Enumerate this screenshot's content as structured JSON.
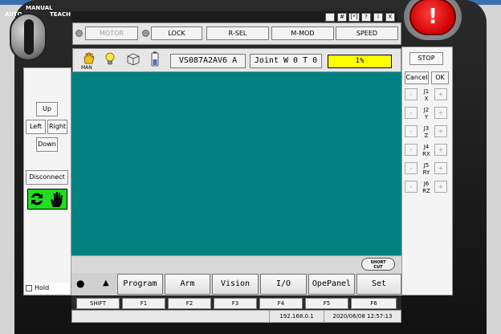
{
  "mode": {
    "auto": "AUTO",
    "manual": "MANUAL",
    "teach": "TEACH"
  },
  "window_buttons": [
    "#",
    "[*]",
    "?",
    "i",
    "X"
  ],
  "top_buttons": {
    "motor": "MOTOR",
    "lock": "LOCK",
    "rsel": "R-SEL",
    "mmod": "M-MOD",
    "speed": "SPEED"
  },
  "status": {
    "man_label": "MAN",
    "robot_name": "VS087A2AV6 A",
    "coord": "Joint  W 0 T 0",
    "speed_value": "1%"
  },
  "left_panel": {
    "up": "Up",
    "left": "Left",
    "right": "Right",
    "down": "Down",
    "disconnect": "Disconnect",
    "hold": "Hold"
  },
  "right_panel": {
    "stop": "STOP",
    "cancel": "Cancel",
    "ok": "OK",
    "minus": "-",
    "plus": "+",
    "joints": [
      {
        "j": "J1",
        "axis": "X"
      },
      {
        "j": "J2",
        "axis": "Y"
      },
      {
        "j": "J3",
        "axis": "Z"
      },
      {
        "j": "J4",
        "axis": "RX"
      },
      {
        "j": "J5",
        "axis": "RY"
      },
      {
        "j": "J6",
        "axis": "RZ"
      }
    ]
  },
  "shortcut": {
    "line1": "SHORT",
    "line2": "CUT"
  },
  "menu": {
    "circle": "●",
    "triangle": "▲",
    "items": [
      "Program",
      "Arm",
      "Vision",
      "I/O",
      "OpePanel",
      "Set"
    ]
  },
  "fkeys": [
    "SHIFT",
    "F1",
    "F2",
    "F3",
    "F4",
    "F5",
    "F6"
  ],
  "info": {
    "ip": "192.168.0.1",
    "datetime": "2020/06/08 12:57:13"
  },
  "colors": {
    "screen": "#008080",
    "speed_bg": "#ffff00",
    "estop": "#d00000",
    "green_panel": "#22dd22"
  }
}
